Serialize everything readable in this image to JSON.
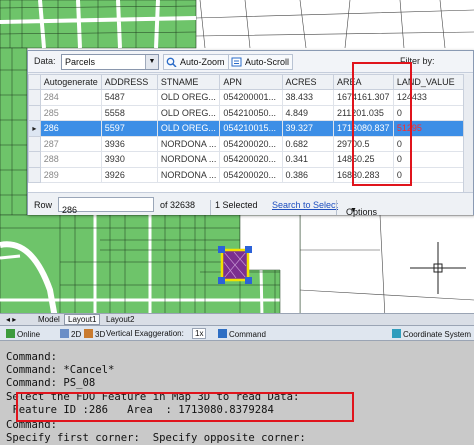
{
  "toolbar": {
    "data_label": "Data:",
    "data_value": "Parcels",
    "auto_zoom": "Auto-Zoom",
    "auto_scroll": "Auto-Scroll",
    "filter_label": "Filter by:"
  },
  "table": {
    "columns": [
      "Autogenerate",
      "ADDRESS",
      "STNAME",
      "APN",
      "ACRES",
      "AREA",
      "LAND_VALUE"
    ],
    "rows": [
      {
        "indicator": "",
        "cells": [
          "284",
          "5487",
          "OLD OREG...",
          "054200001...",
          "38.433",
          "1674161.307",
          "124433"
        ]
      },
      {
        "indicator": "",
        "cells": [
          "285",
          "5558",
          "OLD OREG...",
          "054210050...",
          "4.849",
          "211201.035",
          "0"
        ]
      },
      {
        "indicator": "▸",
        "cells": [
          "286",
          "5597",
          "OLD OREG...",
          "054210015...",
          "39.327",
          "1713080.837",
          "51295"
        ]
      },
      {
        "indicator": "",
        "cells": [
          "287",
          "3936",
          "NORDONA ...",
          "054200020...",
          "0.682",
          "29700.5",
          "0"
        ]
      },
      {
        "indicator": "",
        "cells": [
          "288",
          "3930",
          "NORDONA ...",
          "054200020...",
          "0.341",
          "14850.25",
          "0"
        ]
      },
      {
        "indicator": "",
        "cells": [
          "289",
          "3926",
          "NORDONA ...",
          "054200020...",
          "0.386",
          "16830.283",
          "0"
        ]
      }
    ],
    "selected_row": 2
  },
  "status": {
    "row_label": "Row",
    "row_value": "286",
    "of_count": "of 32638",
    "selected": "1 Selected",
    "zoom_link": "Search to Select",
    "options": "Options"
  },
  "layout_tabs": [
    "Model",
    "Layout1",
    "Layout2"
  ],
  "statusbar": {
    "online": "Online",
    "view2d": "2D",
    "view3d": "3D",
    "vertical_exaggeration": "Vertical Exaggeration:",
    "ve_value": "1x",
    "command": "Command",
    "coordinate_system": "Coordinate System"
  },
  "command_lines": [
    "Command:",
    "Command: *Cancel*",
    "Command: PS_08",
    "Select the FDO Feature in Map 3D to read Data:",
    " Feature ID :286   Area  : 1713080.8379284",
    "Command:",
    "Specify first corner:  Specify opposite corner:"
  ],
  "colors": {
    "parcel_fill": "#6ec46a",
    "selection": "#3c8ee6",
    "highlight_box": "#e0141c",
    "selected_parcel": "#7b2f8f"
  }
}
